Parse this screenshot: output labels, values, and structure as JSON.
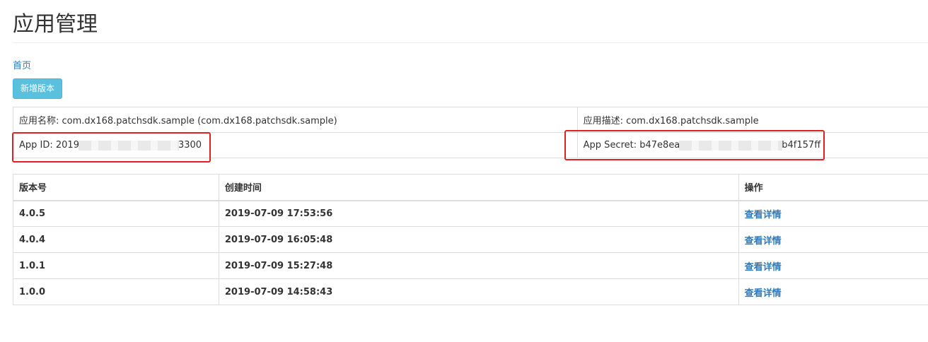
{
  "page": {
    "title": "应用管理"
  },
  "breadcrumb": {
    "home_label": "首页"
  },
  "toolbar": {
    "add_version_label": "新增版本"
  },
  "app_info": {
    "name_label": "应用名称: ",
    "name_value": "com.dx168.patchsdk.sample (com.dx168.patchsdk.sample)",
    "desc_label": "应用描述: ",
    "desc_value": "com.dx168.patchsdk.sample",
    "app_id_label": "App ID: ",
    "app_id_prefix": "2019",
    "app_id_suffix": "3300",
    "app_secret_label": "App Secret: ",
    "app_secret_prefix": "b47e8ea",
    "app_secret_suffix": "b4f157ff"
  },
  "versions": {
    "headers": {
      "version": "版本号",
      "created": "创建时间",
      "action": "操作"
    },
    "rows": [
      {
        "version": "4.0.5",
        "created": "2019-07-09 17:53:56",
        "action": "查看详情"
      },
      {
        "version": "4.0.4",
        "created": "2019-07-09 16:05:48",
        "action": "查看详情"
      },
      {
        "version": "1.0.1",
        "created": "2019-07-09 15:27:48",
        "action": "查看详情"
      },
      {
        "version": "1.0.0",
        "created": "2019-07-09 14:58:43",
        "action": "查看详情"
      }
    ]
  },
  "colors": {
    "link": "#337ab7",
    "info_button": "#5bc0de",
    "highlight_border": "#e02020"
  }
}
